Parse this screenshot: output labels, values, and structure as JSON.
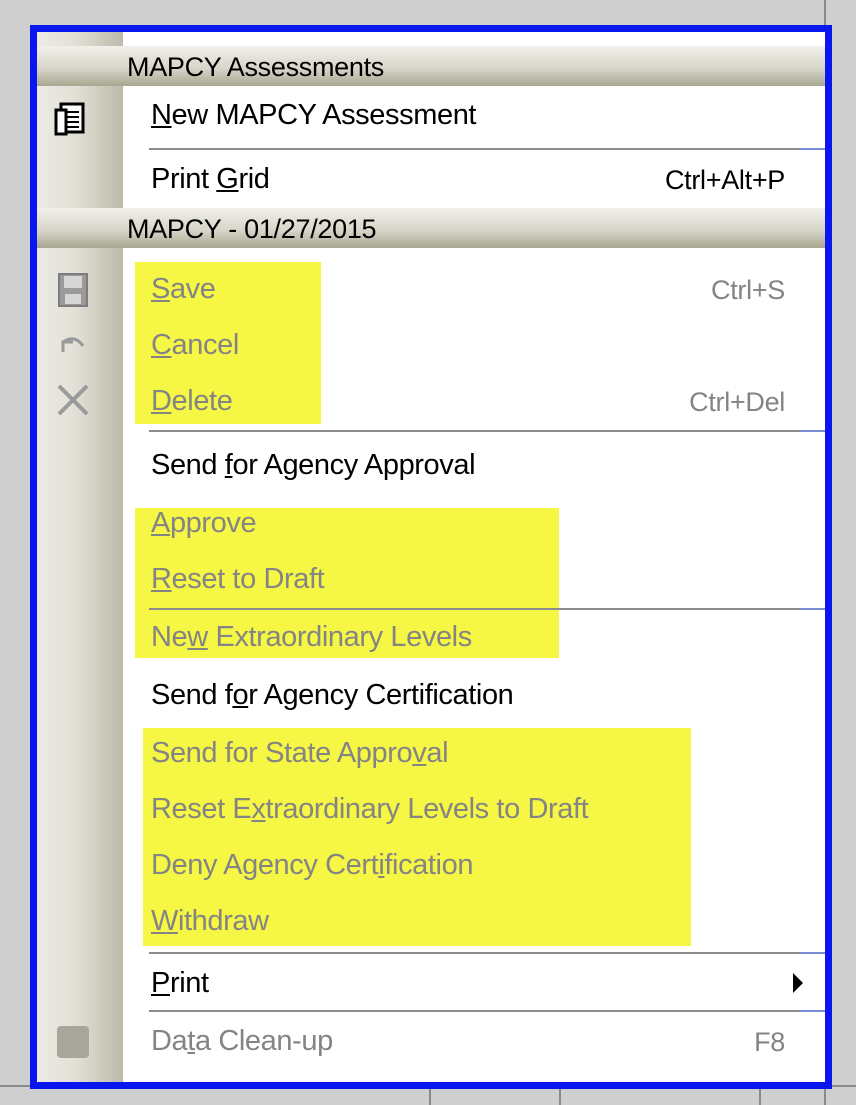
{
  "menu": {
    "header1": "MAPCY Assessments",
    "new_assessment": {
      "pre": "",
      "mn": "N",
      "post": "ew MAPCY Assessment"
    },
    "print_grid": {
      "pre": "Print ",
      "mn": "G",
      "post": "rid",
      "shortcut": "Ctrl+Alt+P"
    },
    "header2": "MAPCY - 01/27/2015",
    "save": {
      "pre": "",
      "mn": "S",
      "post": "ave",
      "shortcut": "Ctrl+S"
    },
    "cancel": {
      "pre": "",
      "mn": "C",
      "post": "ancel"
    },
    "delete": {
      "pre": "",
      "mn": "D",
      "post": "elete",
      "shortcut": "Ctrl+Del"
    },
    "send_agency_approval": {
      "pre": "Send ",
      "mn": "f",
      "post": "or Agency Approval"
    },
    "approve": {
      "pre": "",
      "mn": "A",
      "post": "pprove"
    },
    "reset_draft": {
      "pre": "",
      "mn": "R",
      "post": "eset to Draft"
    },
    "new_extra": {
      "pre": "Ne",
      "mn": "w",
      "post": " Extraordinary Levels"
    },
    "send_agency_cert": {
      "pre": "Send f",
      "mn": "o",
      "post": "r Agency Certification"
    },
    "send_state": {
      "pre": "Send for State Appro",
      "mn": "v",
      "post": "al"
    },
    "reset_extra": {
      "pre": "Reset E",
      "mn": "x",
      "post": "traordinary Levels to Draft"
    },
    "deny_cert": {
      "pre": "Deny Agency Cert",
      "mn": "i",
      "post": "fication"
    },
    "withdraw": {
      "pre": "",
      "mn": "W",
      "post": "ithdraw"
    },
    "print": {
      "pre": "",
      "mn": "P",
      "post": "rint"
    },
    "data_cleanup": {
      "pre": "Da",
      "mn": "t",
      "post": "a Clean-up",
      "shortcut": "F8"
    }
  },
  "colors": {
    "frame": "#0a16ee",
    "highlight": "#f6f645",
    "disabled": "#848484"
  }
}
